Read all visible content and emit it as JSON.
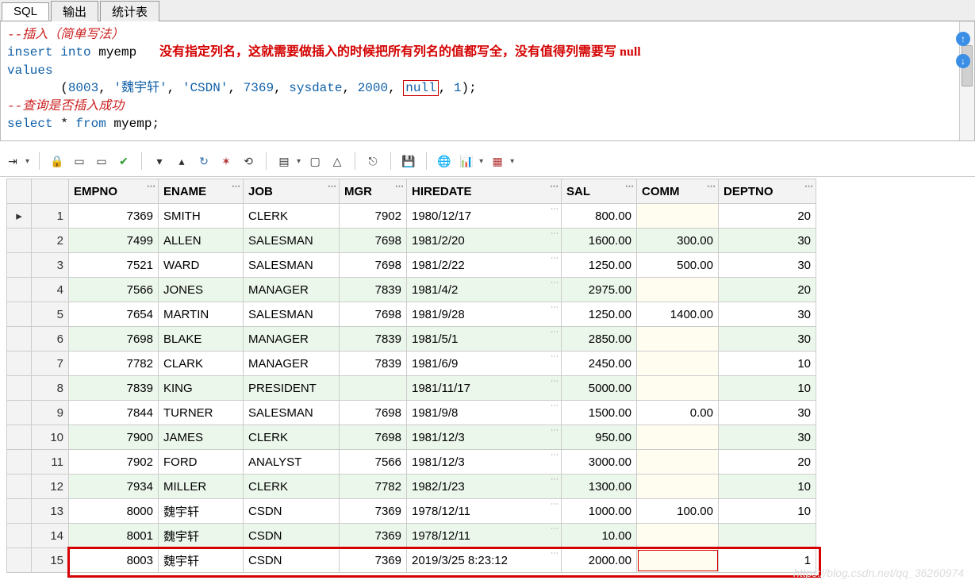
{
  "tabs": {
    "sql": "SQL",
    "output": "输出",
    "stats": "统计表"
  },
  "editor": {
    "c1": "--插入（简单写法）",
    "l2a": "insert",
    "l2b": " into",
    "l2c": " myemp",
    "note": "没有指定列名，这就需要做插入的时候把所有列名的值都写全，没有值得列需要写 null",
    "l3": "values",
    "l4a": "       (",
    "l4b": "8003",
    "l4c": ", ",
    "l4d": "'魏宇轩'",
    "l4e": ", ",
    "l4f": "'CSDN'",
    "l4g": ", ",
    "l4h": "7369",
    "l4i": ", ",
    "l4j": "sysdate",
    "l4k": ", ",
    "l4l": "2000",
    "l4m": ", ",
    "l4n": "null",
    "l4o": ", ",
    "l4p": "1",
    "l4q": ");",
    "c2": "--查询是否插入成功",
    "l6a": "select",
    "l6b": " * ",
    "l6c": "from",
    "l6d": " myemp;"
  },
  "columns": [
    "EMPNO",
    "ENAME",
    "JOB",
    "MGR",
    "HIREDATE",
    "SAL",
    "COMM",
    "DEPTNO"
  ],
  "rows": [
    {
      "n": 1,
      "ptr": "▸",
      "EMPNO": "7369",
      "ENAME": "SMITH",
      "JOB": "CLERK",
      "MGR": "7902",
      "HIREDATE": "1980/12/17",
      "SAL": "800.00",
      "COMM": "",
      "DEPTNO": "20"
    },
    {
      "n": 2,
      "ptr": "",
      "EMPNO": "7499",
      "ENAME": "ALLEN",
      "JOB": "SALESMAN",
      "MGR": "7698",
      "HIREDATE": "1981/2/20",
      "SAL": "1600.00",
      "COMM": "300.00",
      "DEPTNO": "30"
    },
    {
      "n": 3,
      "ptr": "",
      "EMPNO": "7521",
      "ENAME": "WARD",
      "JOB": "SALESMAN",
      "MGR": "7698",
      "HIREDATE": "1981/2/22",
      "SAL": "1250.00",
      "COMM": "500.00",
      "DEPTNO": "30"
    },
    {
      "n": 4,
      "ptr": "",
      "EMPNO": "7566",
      "ENAME": "JONES",
      "JOB": "MANAGER",
      "MGR": "7839",
      "HIREDATE": "1981/4/2",
      "SAL": "2975.00",
      "COMM": "",
      "DEPTNO": "20"
    },
    {
      "n": 5,
      "ptr": "",
      "EMPNO": "7654",
      "ENAME": "MARTIN",
      "JOB": "SALESMAN",
      "MGR": "7698",
      "HIREDATE": "1981/9/28",
      "SAL": "1250.00",
      "COMM": "1400.00",
      "DEPTNO": "30"
    },
    {
      "n": 6,
      "ptr": "",
      "EMPNO": "7698",
      "ENAME": "BLAKE",
      "JOB": "MANAGER",
      "MGR": "7839",
      "HIREDATE": "1981/5/1",
      "SAL": "2850.00",
      "COMM": "",
      "DEPTNO": "30"
    },
    {
      "n": 7,
      "ptr": "",
      "EMPNO": "7782",
      "ENAME": "CLARK",
      "JOB": "MANAGER",
      "MGR": "7839",
      "HIREDATE": "1981/6/9",
      "SAL": "2450.00",
      "COMM": "",
      "DEPTNO": "10"
    },
    {
      "n": 8,
      "ptr": "",
      "EMPNO": "7839",
      "ENAME": "KING",
      "JOB": "PRESIDENT",
      "MGR": "",
      "HIREDATE": "1981/11/17",
      "SAL": "5000.00",
      "COMM": "",
      "DEPTNO": "10"
    },
    {
      "n": 9,
      "ptr": "",
      "EMPNO": "7844",
      "ENAME": "TURNER",
      "JOB": "SALESMAN",
      "MGR": "7698",
      "HIREDATE": "1981/9/8",
      "SAL": "1500.00",
      "COMM": "0.00",
      "DEPTNO": "30"
    },
    {
      "n": 10,
      "ptr": "",
      "EMPNO": "7900",
      "ENAME": "JAMES",
      "JOB": "CLERK",
      "MGR": "7698",
      "HIREDATE": "1981/12/3",
      "SAL": "950.00",
      "COMM": "",
      "DEPTNO": "30"
    },
    {
      "n": 11,
      "ptr": "",
      "EMPNO": "7902",
      "ENAME": "FORD",
      "JOB": "ANALYST",
      "MGR": "7566",
      "HIREDATE": "1981/12/3",
      "SAL": "3000.00",
      "COMM": "",
      "DEPTNO": "20"
    },
    {
      "n": 12,
      "ptr": "",
      "EMPNO": "7934",
      "ENAME": "MILLER",
      "JOB": "CLERK",
      "MGR": "7782",
      "HIREDATE": "1982/1/23",
      "SAL": "1300.00",
      "COMM": "",
      "DEPTNO": "10"
    },
    {
      "n": 13,
      "ptr": "",
      "EMPNO": "8000",
      "ENAME": "魏宇轩",
      "JOB": "CSDN",
      "MGR": "7369",
      "HIREDATE": "1978/12/11",
      "SAL": "1000.00",
      "COMM": "100.00",
      "DEPTNO": "10"
    },
    {
      "n": 14,
      "ptr": "",
      "EMPNO": "8001",
      "ENAME": "魏宇轩",
      "JOB": "CSDN",
      "MGR": "7369",
      "HIREDATE": "1978/12/11",
      "SAL": "10.00",
      "COMM": "",
      "DEPTNO": ""
    },
    {
      "n": 15,
      "ptr": "",
      "EMPNO": "8003",
      "ENAME": "魏宇轩",
      "JOB": "CSDN",
      "MGR": "7369",
      "HIREDATE": "2019/3/25 8:23:12",
      "SAL": "2000.00",
      "COMM": "",
      "DEPTNO": "1"
    }
  ],
  "watermark": "https://blog.csdn.net/qq_36260974",
  "arrows": {
    "up": "↑",
    "down": "↓"
  },
  "colwidths": {
    "ptr": 18,
    "n": 34,
    "EMPNO": 100,
    "ENAME": 94,
    "JOB": 108,
    "MGR": 72,
    "HIREDATE": 182,
    "SAL": 82,
    "COMM": 90,
    "DEPTNO": 110
  }
}
